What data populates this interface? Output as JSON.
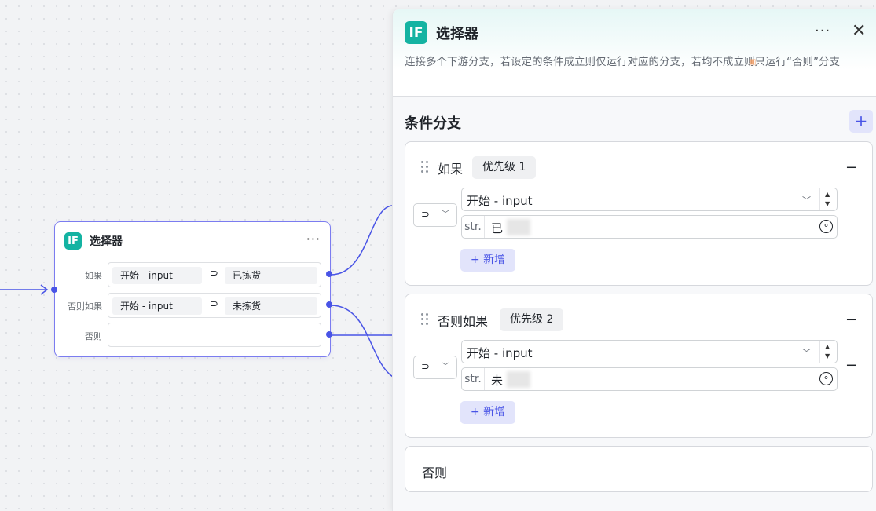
{
  "node": {
    "title": "选择器",
    "badge": "IF",
    "more": "···",
    "rows": [
      {
        "label": "如果",
        "left": "开始  -  input",
        "op": "⊃",
        "right": "已拣货"
      },
      {
        "label": "否则如果",
        "left": "开始  -  input",
        "op": "⊃",
        "right": "未拣货"
      },
      {
        "label": "否则",
        "left": "",
        "op": "",
        "right": ""
      }
    ]
  },
  "panel": {
    "badge": "IF",
    "title": "选择器",
    "more": "···",
    "close": "✕",
    "description": "连接多个下游分支，若设定的条件成立则仅运行对应的分支，若均不成立则只运行“否则”分支",
    "section_title": "条件分支",
    "add_icon": "+",
    "branches": [
      {
        "label": "如果",
        "priority": "优先级 1",
        "operator": "⊃",
        "variable": "开始 - input",
        "value_type": "str.",
        "value": "已",
        "add_label": "+ 新增"
      },
      {
        "label": "否则如果",
        "priority": "优先级 2",
        "operator": "⊃",
        "variable": "开始 - input",
        "value_type": "str.",
        "value": "未",
        "add_label": "+ 新增"
      }
    ],
    "else_label": "否则"
  },
  "colors": {
    "accent": "#4954e6",
    "badge": "#14b3a2",
    "node_border": "#7b7cf0"
  }
}
